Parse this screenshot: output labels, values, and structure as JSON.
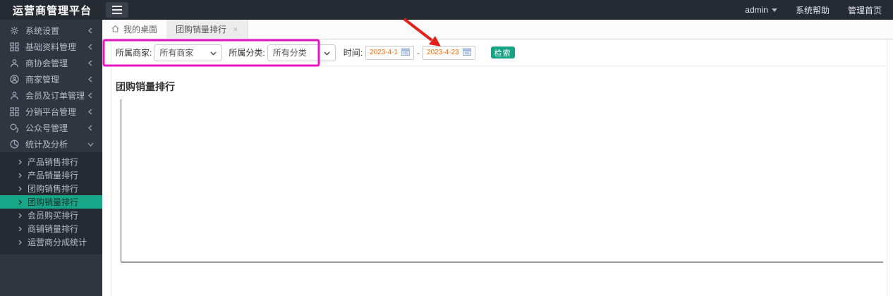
{
  "topbar": {
    "logo": "运营商管理平台",
    "admin": "admin",
    "links": [
      {
        "label": "系统帮助"
      },
      {
        "label": "管理首页"
      }
    ]
  },
  "sidebar": {
    "items": [
      {
        "label": "系统设置",
        "icon": "gear-icon"
      },
      {
        "label": "基础资料管理",
        "icon": "grid-icon"
      },
      {
        "label": "商协会管理",
        "icon": "user-icon"
      },
      {
        "label": "商家管理",
        "icon": "user-circle-icon"
      },
      {
        "label": "会员及订单管理",
        "icon": "member-icon"
      },
      {
        "label": "分销平台管理",
        "icon": "th-icon"
      },
      {
        "label": "公众号管理",
        "icon": "wechat-icon"
      },
      {
        "label": "统计及分析",
        "icon": "pie-chart-icon",
        "expanded": true
      }
    ],
    "submenu": [
      {
        "label": "产品销售排行"
      },
      {
        "label": "产品销量排行"
      },
      {
        "label": "团购销售排行"
      },
      {
        "label": "团购销量排行",
        "active": true
      },
      {
        "label": "会员购买排行"
      },
      {
        "label": "商铺销量排行"
      },
      {
        "label": "运营商分成统计"
      }
    ]
  },
  "tabs": {
    "desktop": "我的桌面",
    "active_tab": "团购销量排行",
    "close": "×"
  },
  "filters": {
    "merchant_label": "所属商家:",
    "merchant_value": "所有商家",
    "category_label": "所属分类:",
    "category_value": "所有分类",
    "time_label": "时间:",
    "date_start": "2023-4-1",
    "date_range_separator": "-",
    "date_end": "2023-4-23",
    "search_button": "检索"
  },
  "chart": {
    "title": "团购销量排行",
    "empty": true
  },
  "colors": {
    "accent_teal": "#18a689",
    "button_teal": "#17a283",
    "date_text": "#ff6600",
    "annotation_pink": "#e516c0",
    "annotation_red": "#e0241b",
    "sidebar_bg": "#30353f",
    "topbar_bg": "#262a32"
  }
}
